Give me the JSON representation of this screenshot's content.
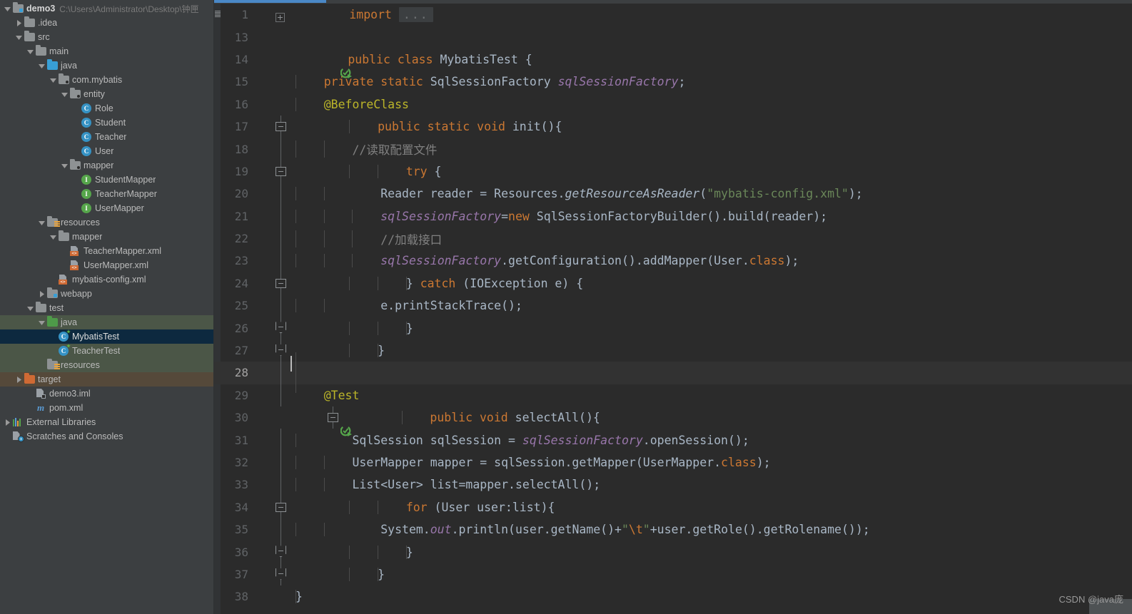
{
  "window": {
    "theme_bg": "#3c3f41",
    "editor_bg": "#2b2b2b",
    "accent": "#4a88c7"
  },
  "sidebar": {
    "project": {
      "name": "demo3",
      "path": "C:\\Users\\Administrator\\Desktop\\钟匣"
    },
    "items": [
      {
        "label": ".idea",
        "indent": 1,
        "icon": "folder-icon",
        "twisty": "collapsed",
        "row": "normal"
      },
      {
        "label": "src",
        "indent": 1,
        "icon": "folder-icon",
        "twisty": "expanded",
        "row": "normal"
      },
      {
        "label": "main",
        "indent": 2,
        "icon": "folder-icon",
        "twisty": "expanded",
        "row": "normal"
      },
      {
        "label": "java",
        "indent": 3,
        "icon": "source-folder-icon",
        "twisty": "expanded",
        "row": "normal"
      },
      {
        "label": "com.mybatis",
        "indent": 4,
        "icon": "package-icon",
        "twisty": "expanded",
        "row": "normal"
      },
      {
        "label": "entity",
        "indent": 5,
        "icon": "package-icon",
        "twisty": "expanded",
        "row": "normal"
      },
      {
        "label": "Role",
        "indent": 6,
        "icon": "java-class-icon",
        "twisty": "none",
        "row": "normal"
      },
      {
        "label": "Student",
        "indent": 6,
        "icon": "java-class-icon",
        "twisty": "none",
        "row": "normal"
      },
      {
        "label": "Teacher",
        "indent": 6,
        "icon": "java-class-icon",
        "twisty": "none",
        "row": "normal"
      },
      {
        "label": "User",
        "indent": 6,
        "icon": "java-class-icon",
        "twisty": "none",
        "row": "normal"
      },
      {
        "label": "mapper",
        "indent": 5,
        "icon": "package-icon",
        "twisty": "expanded",
        "row": "normal"
      },
      {
        "label": "StudentMapper",
        "indent": 6,
        "icon": "java-interface-icon",
        "twisty": "none",
        "row": "normal"
      },
      {
        "label": "TeacherMapper",
        "indent": 6,
        "icon": "java-interface-icon",
        "twisty": "none",
        "row": "normal"
      },
      {
        "label": "UserMapper",
        "indent": 6,
        "icon": "java-interface-icon",
        "twisty": "none",
        "row": "normal"
      },
      {
        "label": "resources",
        "indent": 3,
        "icon": "resources-folder-icon",
        "twisty": "expanded",
        "row": "normal"
      },
      {
        "label": "mapper",
        "indent": 4,
        "icon": "folder-icon",
        "twisty": "expanded",
        "row": "normal"
      },
      {
        "label": "TeacherMapper.xml",
        "indent": 5,
        "icon": "xml-file-icon",
        "twisty": "none",
        "row": "normal"
      },
      {
        "label": "UserMapper.xml",
        "indent": 5,
        "icon": "xml-file-icon",
        "twisty": "none",
        "row": "normal"
      },
      {
        "label": "mybatis-config.xml",
        "indent": 4,
        "icon": "xml-file-icon",
        "twisty": "none",
        "row": "normal"
      },
      {
        "label": "webapp",
        "indent": 3,
        "icon": "webapp-folder-icon",
        "twisty": "collapsed",
        "row": "normal"
      },
      {
        "label": "test",
        "indent": 2,
        "icon": "folder-icon",
        "twisty": "expanded",
        "row": "normal"
      },
      {
        "label": "java",
        "indent": 3,
        "icon": "test-source-folder-icon",
        "twisty": "expanded",
        "row": "green"
      },
      {
        "label": "MybatisTest",
        "indent": 4,
        "icon": "java-test-class-icon",
        "twisty": "none",
        "row": "selected"
      },
      {
        "label": "TeacherTest",
        "indent": 4,
        "icon": "java-test-class-icon",
        "twisty": "none",
        "row": "green"
      },
      {
        "label": "resources",
        "indent": 3,
        "icon": "test-resources-folder-icon",
        "twisty": "none",
        "row": "green"
      },
      {
        "label": "target",
        "indent": 1,
        "icon": "excluded-folder-icon",
        "twisty": "collapsed",
        "row": "brown"
      },
      {
        "label": "demo3.iml",
        "indent": 2,
        "icon": "iml-file-icon",
        "twisty": "none",
        "row": "normal"
      },
      {
        "label": "pom.xml",
        "indent": 2,
        "icon": "maven-file-icon",
        "twisty": "none",
        "row": "normal"
      },
      {
        "label": "External Libraries",
        "indent": 0,
        "icon": "libraries-icon",
        "twisty": "collapsed",
        "row": "normal"
      },
      {
        "label": "Scratches and Consoles",
        "indent": 0,
        "icon": "scratches-icon",
        "twisty": "none",
        "row": "normal"
      }
    ]
  },
  "editor": {
    "file": "MybatisTest.java",
    "current_line": 28,
    "lines": [
      {
        "n": "1",
        "fold": "plus-box"
      },
      {
        "n": "13",
        "fold": "none"
      },
      {
        "n": "14",
        "fold": "none",
        "run": true
      },
      {
        "n": "15",
        "fold": "none"
      },
      {
        "n": "16",
        "fold": "none"
      },
      {
        "n": "17",
        "fold": "minus"
      },
      {
        "n": "18",
        "fold": "none"
      },
      {
        "n": "19",
        "fold": "minus"
      },
      {
        "n": "20",
        "fold": "none"
      },
      {
        "n": "21",
        "fold": "none"
      },
      {
        "n": "22",
        "fold": "none"
      },
      {
        "n": "23",
        "fold": "none"
      },
      {
        "n": "24",
        "fold": "minus"
      },
      {
        "n": "25",
        "fold": "none"
      },
      {
        "n": "26",
        "fold": "cap-bottom"
      },
      {
        "n": "27",
        "fold": "cap-bottom"
      },
      {
        "n": "28",
        "fold": "none"
      },
      {
        "n": "29",
        "fold": "none"
      },
      {
        "n": "30",
        "fold": "minus",
        "run": true
      },
      {
        "n": "31",
        "fold": "none"
      },
      {
        "n": "32",
        "fold": "none"
      },
      {
        "n": "33",
        "fold": "none"
      },
      {
        "n": "34",
        "fold": "minus"
      },
      {
        "n": "35",
        "fold": "none"
      },
      {
        "n": "36",
        "fold": "cap-bottom"
      },
      {
        "n": "37",
        "fold": "cap-bottom"
      },
      {
        "n": "38",
        "fold": "none"
      }
    ],
    "code": {
      "l1_import": "import",
      "l1_folded": "...",
      "l13": "",
      "l14_a": "public class ",
      "l14_b": "MybatisTest",
      "l14_c": " {",
      "l15_a": "    private static ",
      "l15_b": "SqlSessionFactory ",
      "l15_c": "sqlSessionFactory",
      "l15_d": ";",
      "l16": "    @BeforeClass",
      "l17_a": "    public static void ",
      "l17_b": "init",
      "l17_c": "(){",
      "l18": "        //读取配置文件",
      "l19_a": "        try",
      "l19_b": " {",
      "l20_a": "            Reader reader = Resources.",
      "l20_b": "getResourceAsReader",
      "l20_c": "(",
      "l20_d": "\"mybatis-config.xml\"",
      "l20_e": ");",
      "l21_a": "            ",
      "l21_b": "sqlSessionFactory",
      "l21_c": "=",
      "l21_d": "new",
      "l21_e": " SqlSessionFactoryBuilder().build(reader);",
      "l22": "            //加载接口",
      "l23_a": "            ",
      "l23_b": "sqlSessionFactory",
      "l23_c": ".getConfiguration().addMapper(User.",
      "l23_d": "class",
      "l23_e": ");",
      "l24_a": "        } ",
      "l24_b": "catch",
      "l24_c": " (IOException e) {",
      "l25": "            e.printStackTrace();",
      "l26": "        }",
      "l27": "    }",
      "l28": "",
      "l29": "    @Test",
      "l30_a": "    public void ",
      "l30_b": "selectAll",
      "l30_c": "(){",
      "l31_a": "        SqlSession sqlSession = ",
      "l31_b": "sqlSessionFactory",
      "l31_c": ".openSession();",
      "l32_a": "        UserMapper mapper = sqlSession.getMapper(UserMapper.",
      "l32_b": "class",
      "l32_c": ");",
      "l33": "        List<User> list=mapper.selectAll();",
      "l34_a": "        for",
      "l34_b": " (User user:list){",
      "l35_a": "            System.",
      "l35_b": "out",
      "l35_c": ".println(user.getName()+",
      "l35_d": "\"",
      "l35_e": "\\t",
      "l35_f": "\"",
      "l35_g": "+user.getRole().getRolename());",
      "l36": "        }",
      "l37": "    }",
      "l38": "}"
    }
  },
  "watermark": {
    "text": "CSDN @java庞"
  }
}
